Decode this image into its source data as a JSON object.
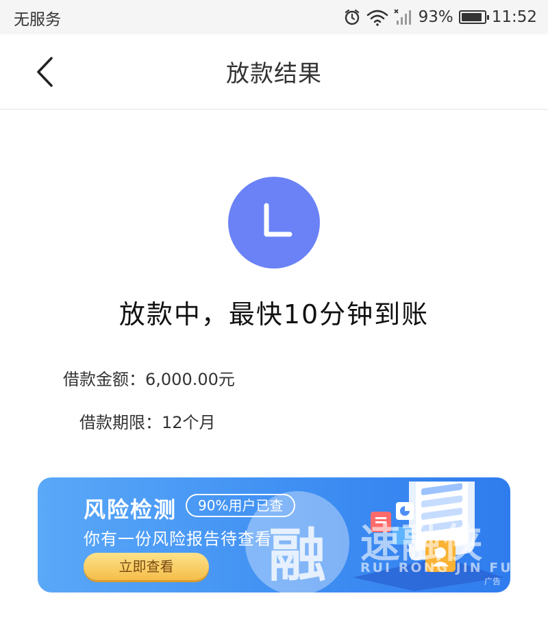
{
  "status_bar": {
    "carrier": "无服务",
    "battery_percent": "93%",
    "battery_level": 0.93,
    "time": "11:52",
    "icons": [
      "alarm-icon",
      "wifi-icon",
      "signal-icon",
      "battery-icon"
    ]
  },
  "nav": {
    "back_icon": "chevron-left-icon",
    "title": "放款结果"
  },
  "result": {
    "icon": "clock-icon",
    "accent_color": "#6a82f6",
    "message": "放款中，最快10分钟到账",
    "amount_label": "借款金额：",
    "amount_value": "6,000.00元",
    "term_label": "借款期限：",
    "term_value": "12个月"
  },
  "banner": {
    "title": "风险检测",
    "pill": "90%用户已查",
    "subtitle": "你有一份风险报告待查看",
    "button": "立即查看",
    "ad_tag": "广告"
  },
  "watermark": {
    "char": "融",
    "brand": "速融侠",
    "pinyin": "RUI  RONG  JIN FU"
  }
}
